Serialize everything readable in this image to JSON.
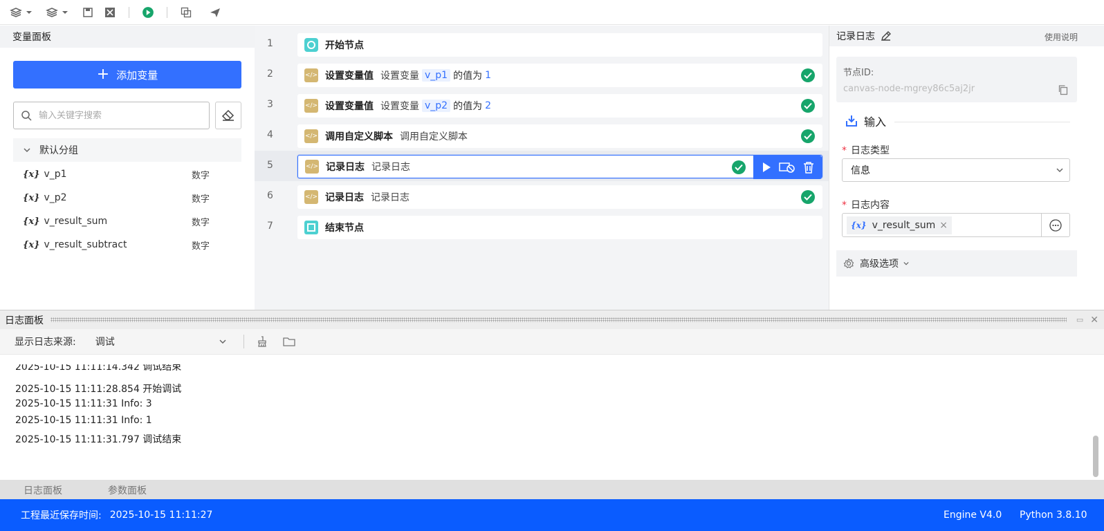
{
  "toolbar": {
    "icons": [
      "layers-dropdown-icon",
      "layers-plus-dropdown-icon",
      "save-icon",
      "close-icon",
      "run-icon",
      "copy-icon",
      "send-icon"
    ]
  },
  "left_panel": {
    "title": "变量面板",
    "add_button": "添加变量",
    "search_placeholder": "输入关键字搜索",
    "group": "默认分组",
    "variables": [
      {
        "name": "v_p1",
        "type": "数字"
      },
      {
        "name": "v_p2",
        "type": "数字"
      },
      {
        "name": "v_result_sum",
        "type": "数字"
      },
      {
        "name": "v_result_subtract",
        "type": "数字"
      }
    ]
  },
  "canvas": {
    "rows": [
      {
        "num": "1",
        "title": "开始节点"
      },
      {
        "num": "2",
        "title": "设置变量值",
        "desc_prefix": "设置变量",
        "var": "v_p1",
        "desc_mid": "的值为",
        "value": "1"
      },
      {
        "num": "3",
        "title": "设置变量值",
        "desc_prefix": "设置变量",
        "var": "v_p2",
        "desc_mid": "的值为",
        "value": "2"
      },
      {
        "num": "4",
        "title": "调用自定义脚本",
        "desc": "调用自定义脚本"
      },
      {
        "num": "5",
        "title": "记录日志",
        "desc": "记录日志"
      },
      {
        "num": "6",
        "title": "记录日志",
        "desc": "记录日志"
      },
      {
        "num": "7",
        "title": "结束节点"
      }
    ]
  },
  "right_panel": {
    "title": "记录日志",
    "help": "使用说明",
    "node_id_label": "节点ID:",
    "node_id": "canvas-node-mgrey86c5aj2jr",
    "section": "输入",
    "log_type_label": "日志类型",
    "log_type_value": "信息",
    "log_content_label": "日志内容",
    "log_content_var": "v_result_sum",
    "advanced": "高级选项"
  },
  "log_panel": {
    "title": "日志面板",
    "source_label": "显示日志来源:",
    "source_value": "调试",
    "lines": [
      "2025-10-15 11:11:14.342 调试结束",
      "2025-10-15 11:11:28.854 开始调试",
      "2025-10-15 11:11:31 Info: 3",
      "2025-10-15 11:11:31 Info: 1",
      "2025-10-15 11:11:31.797 调试结束"
    ],
    "tabs": [
      "日志面板",
      "参数面板"
    ]
  },
  "status": {
    "save_label": "工程最近保存时间:",
    "save_time": "2025-10-15 11:11:27",
    "engine": "Engine V4.0",
    "python": "Python 3.8.10"
  },
  "colors": {
    "accent": "#3370ff",
    "status_bar": "#0a5cff",
    "success": "#17a56b",
    "node_code": "#d4b772",
    "node_start": "#4dd0d1"
  }
}
